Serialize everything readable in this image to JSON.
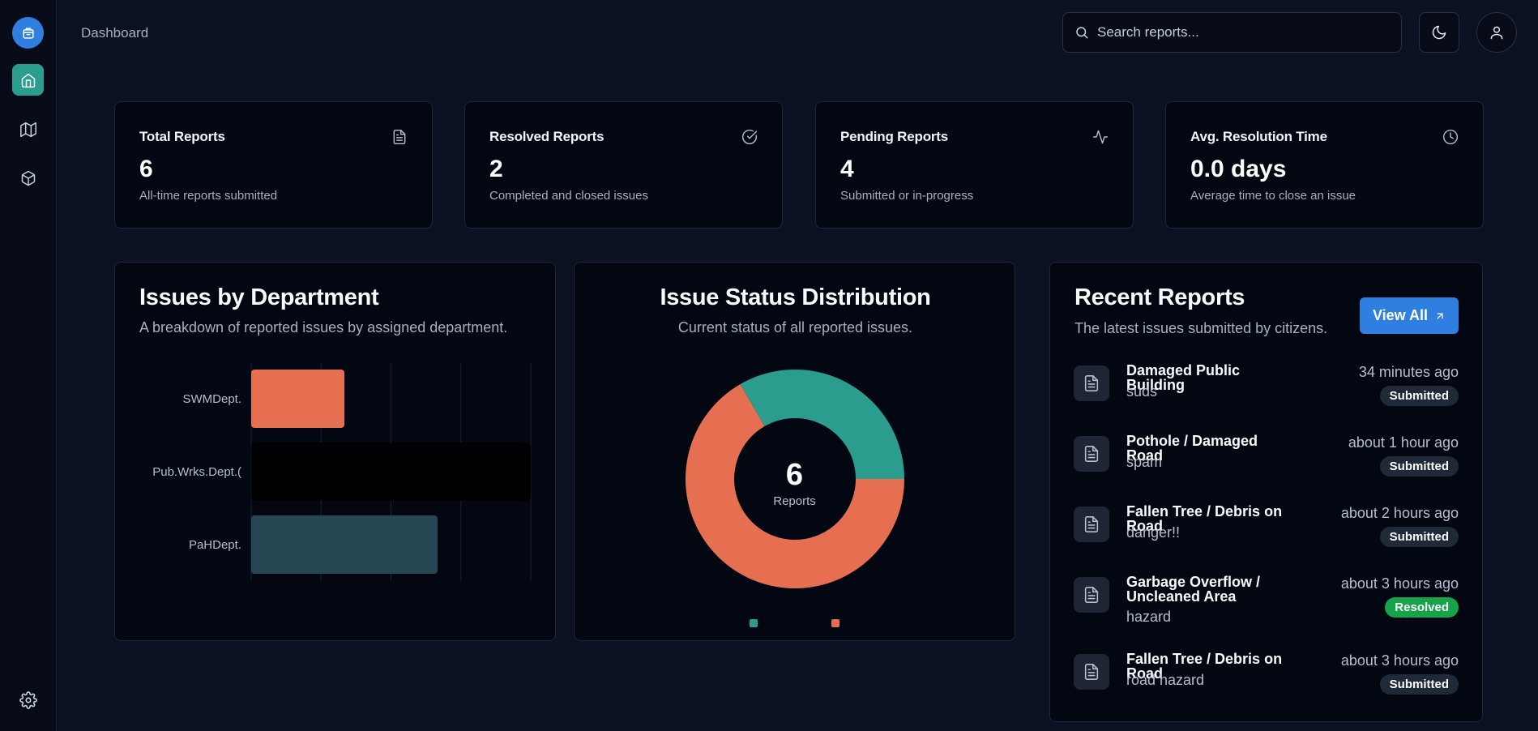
{
  "header": {
    "breadcrumb": "Dashboard",
    "search_placeholder": "Search reports..."
  },
  "sidebar": {
    "logo_icon": "box-logo-icon",
    "items": [
      {
        "name": "home",
        "icon": "home-icon",
        "active": true
      },
      {
        "name": "map",
        "icon": "map-icon",
        "active": false
      },
      {
        "name": "package",
        "icon": "package-icon",
        "active": false
      }
    ],
    "settings_icon": "gear-icon"
  },
  "stats": [
    {
      "title": "Total Reports",
      "value": "6",
      "desc": "All-time reports submitted",
      "icon": "file-text-icon"
    },
    {
      "title": "Resolved Reports",
      "value": "2",
      "desc": "Completed and closed issues",
      "icon": "check-circle-icon"
    },
    {
      "title": "Pending Reports",
      "value": "4",
      "desc": "Submitted or in-progress",
      "icon": "activity-icon"
    },
    {
      "title": "Avg. Resolution Time",
      "value": "0.0 days",
      "desc": "Average time to close an issue",
      "icon": "clock-icon"
    }
  ],
  "issues_by_department": {
    "title": "Issues by Department",
    "subtitle": "A breakdown of reported issues by assigned department."
  },
  "status_distribution": {
    "title": "Issue Status Distribution",
    "subtitle": "Current status of all reported issues.",
    "center_value": "6",
    "center_label": "Reports"
  },
  "recent_reports": {
    "title": "Recent Reports",
    "subtitle": "The latest issues submitted by citizens.",
    "view_all_label": "View All",
    "items": [
      {
        "title": "Damaged Public Building",
        "description": "suds",
        "time": "34 minutes ago",
        "status": "Submitted"
      },
      {
        "title": "Pothole / Damaged Road",
        "description": "spam",
        "time": "about 1 hour ago",
        "status": "Submitted"
      },
      {
        "title": "Fallen Tree / Debris on Road",
        "description": "danger!!",
        "time": "about 2 hours ago",
        "status": "Submitted"
      },
      {
        "title": "Garbage Overflow / Uncleaned Area",
        "description": "hazard",
        "time": "about 3 hours ago",
        "status": "Resolved"
      },
      {
        "title": "Fallen Tree / Debris on Road",
        "description": "road hazard",
        "time": "about 3 hours ago",
        "status": "Submitted"
      }
    ]
  },
  "colors": {
    "accent": "#2f7fe0",
    "teal": "#2a9d8f",
    "coral": "#e76f51",
    "slate_bar": "#264653",
    "black_bar": "#000000",
    "badge_submitted": "#1f2937",
    "badge_resolved": "#16a34a"
  },
  "chart_data": [
    {
      "type": "bar",
      "orientation": "horizontal",
      "categories": [
        "SWMDept.",
        "Pub.Wrks.Dept.(",
        "PaHDept."
      ],
      "values": [
        1,
        3,
        2
      ],
      "colors": [
        "#e76f51",
        "#000000",
        "#264653"
      ],
      "xlim": [
        0,
        3
      ],
      "grid": true
    },
    {
      "type": "pie",
      "donut": true,
      "slices": [
        {
          "value": 2,
          "color": "#2a9d8f"
        },
        {
          "value": 4,
          "color": "#e76f51"
        }
      ],
      "legend_placement": "bottom"
    }
  ]
}
